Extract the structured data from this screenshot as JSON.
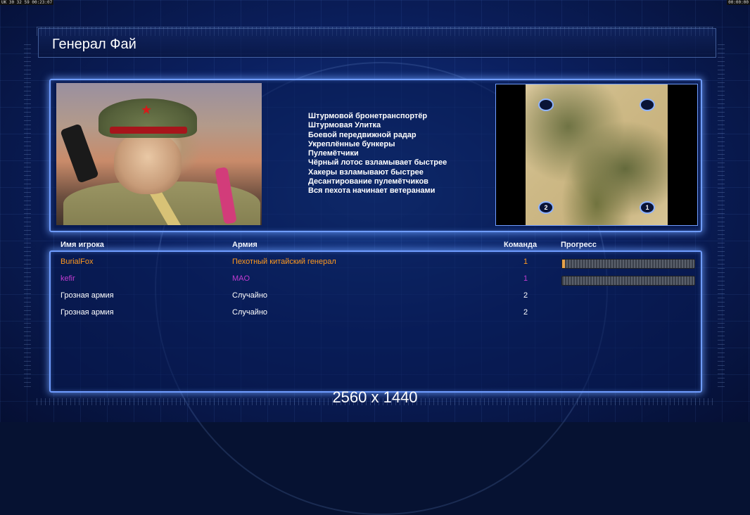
{
  "hud": {
    "left": "UK 30 32 59 00:23:07",
    "right": "00:00:00"
  },
  "title": "Генерал Фай",
  "features": [
    "Штурмовой бронетранспортёр",
    "Штурмовая Улитка",
    "Боевой передвижной радар",
    "Укреплённые бункеры",
    "Пулемётчики",
    "Чёрный лотос взламывает быстрее",
    "Хакеры взламывают быстрее",
    "Десантирование пулемётчиков",
    "Вся пехота начинает ветеранами"
  ],
  "map": {
    "spawns": [
      "2",
      "1"
    ]
  },
  "table": {
    "headers": {
      "player": "Имя игрока",
      "army": "Армия",
      "team": "Команда",
      "progress": "Прогресс"
    },
    "rows": [
      {
        "name": "BurialFox",
        "army": "Пехотный китайский генерал",
        "team": "1",
        "color": "#ff9a1f",
        "progress": 0.02
      },
      {
        "name": "kefir",
        "army": "MAO",
        "team": "1",
        "color": "#c23cd1",
        "progress": 0.0
      },
      {
        "name": "Грозная армия",
        "army": "Случайно",
        "team": "2",
        "color": "#ffffff"
      },
      {
        "name": "Грозная армия",
        "army": "Случайно",
        "team": "2",
        "color": "#ffffff"
      }
    ]
  },
  "resolution_label": "2560 x 1440"
}
